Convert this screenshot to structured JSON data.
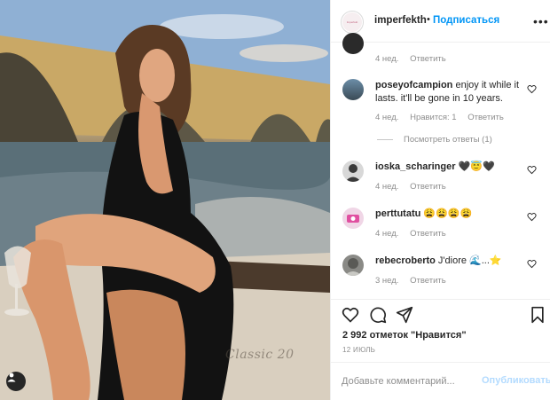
{
  "post": {
    "watermark_text": "Classic 20"
  },
  "header": {
    "avatar_text": "Imperfekt",
    "username": "imperfekth",
    "separator": "•",
    "follow_label": "Подписаться",
    "more_label": "•••"
  },
  "comments": [
    {
      "username": "",
      "text": "",
      "time": "4 нед.",
      "likes": "",
      "reply_label": "Ответить"
    },
    {
      "username": "poseyofcampion",
      "text": "enjoy it while it lasts. it'll be gone in 10 years.",
      "time": "4 нед.",
      "likes": "Нравится: 1",
      "reply_label": "Ответить",
      "view_replies": "Посмотреть ответы (1)"
    },
    {
      "username": "ioska_scharinger",
      "text": "🖤😇🖤",
      "time": "4 нед.",
      "reply_label": "Ответить"
    },
    {
      "username": "perttutatu",
      "text": "😩😩😩😩",
      "time": "4 нед.",
      "reply_label": "Ответить"
    },
    {
      "username": "rebecroberto",
      "text": "J'diore 🌊...⭐",
      "time": "3 нед.",
      "reply_label": "Ответить"
    }
  ],
  "footer": {
    "likes_count": "2 992 отметок \"Нравится\"",
    "date": "12 ИЮЛЬ",
    "comment_placeholder": "Добавьте комментарий...",
    "publish_label": "Опубликовать"
  },
  "colors": {
    "accent": "#0095f6",
    "publish_disabled": "#b3dbff",
    "text": "#262626",
    "muted": "#8e8e8e"
  }
}
